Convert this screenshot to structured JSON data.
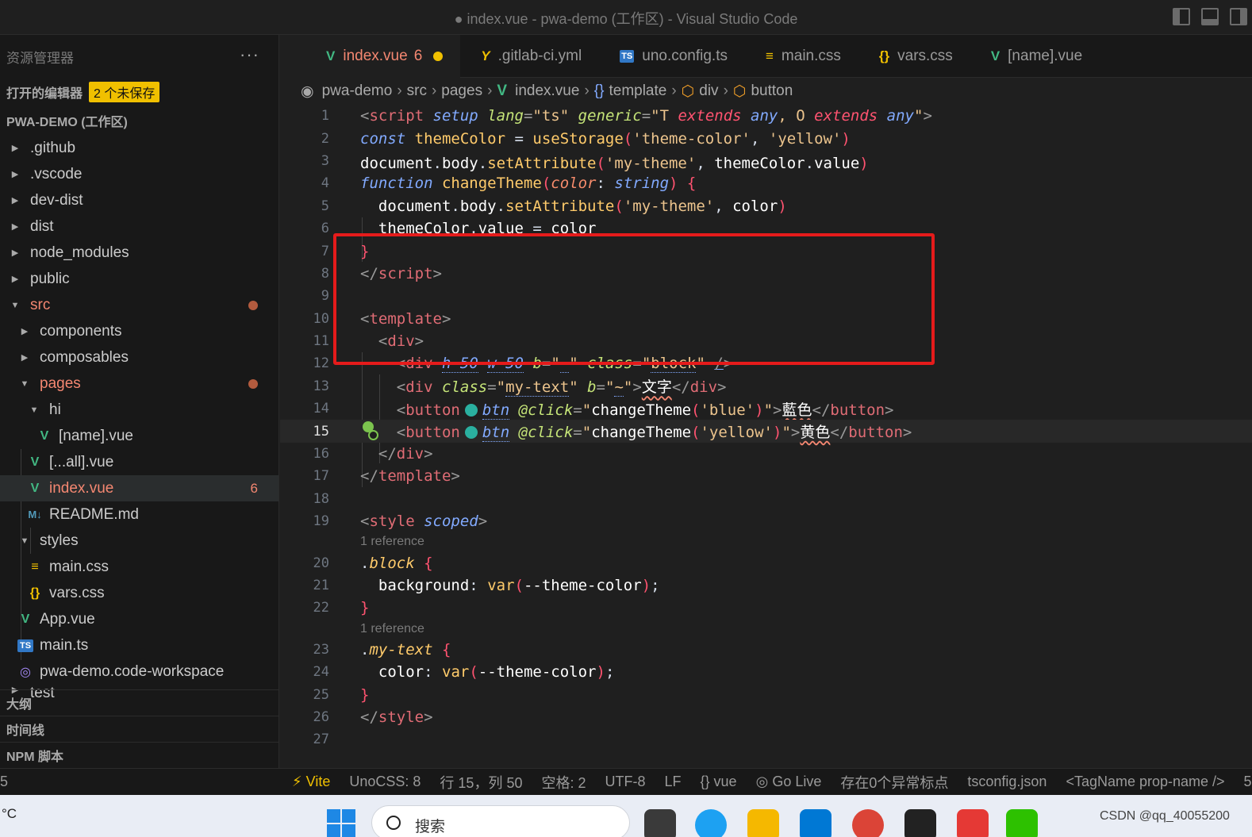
{
  "window": {
    "title": "● index.vue - pwa-demo (工作区) - Visual Studio Code"
  },
  "sidebar": {
    "header": "资源管理器",
    "more": "···",
    "open_editors": "打开的编辑器",
    "unsaved_badge": "2 个未保存",
    "workspace": "PWA-DEMO (工作区)",
    "items": [
      {
        "label": ".github"
      },
      {
        "label": ".vscode"
      },
      {
        "label": "dev-dist"
      },
      {
        "label": "dist"
      },
      {
        "label": "node_modules"
      },
      {
        "label": "public"
      },
      {
        "label": "src"
      },
      {
        "label": "components"
      },
      {
        "label": "composables"
      },
      {
        "label": "pages"
      },
      {
        "label": "hi"
      },
      {
        "label": "[name].vue"
      },
      {
        "label": "[...all].vue"
      },
      {
        "label": "index.vue",
        "count": "6"
      },
      {
        "label": "README.md"
      },
      {
        "label": "styles"
      },
      {
        "label": "main.css"
      },
      {
        "label": "vars.css"
      },
      {
        "label": "App.vue"
      },
      {
        "label": "main.ts"
      },
      {
        "label": "pwa-demo.code-workspace"
      },
      {
        "label": "test"
      }
    ],
    "bottom_sections": [
      "大纲",
      "时间线",
      "NPM 脚本"
    ]
  },
  "tabs": [
    {
      "label": "index.vue",
      "icon": "vue-icon",
      "errors": "6",
      "active": true
    },
    {
      "label": ".gitlab-ci.yml",
      "icon": "yaml-icon"
    },
    {
      "label": "uno.config.ts",
      "icon": "ts-icon"
    },
    {
      "label": "main.css",
      "icon": "css-icon"
    },
    {
      "label": "vars.css",
      "icon": "css-braces-icon"
    },
    {
      "label": "[name].vue",
      "icon": "vue-icon"
    }
  ],
  "breadcrumb": [
    "pwa-demo",
    "src",
    "pages",
    "index.vue",
    "template",
    "div",
    "button"
  ],
  "editor": {
    "current_line": "15",
    "codelens": "1 reference",
    "line_numbers": [
      "1",
      "2",
      "3",
      "4",
      "5",
      "6",
      "7",
      "8",
      "9",
      "10",
      "11",
      "12",
      "13",
      "14",
      "15",
      "16",
      "17",
      "18",
      "19",
      "20",
      "21",
      "22",
      "23",
      "24",
      "25",
      "26",
      "27"
    ]
  },
  "statusbar": {
    "vite": "Vite",
    "unocss": "UnoCSS: 8",
    "position": "行 15，列 50",
    "spaces": "空格: 2",
    "encoding": "UTF-8",
    "eol": "LF",
    "language": "vue",
    "golive": "Go Live",
    "problems": "存在0个异常标点",
    "tsconfig": "tsconfig.json",
    "tagname": "<TagName prop-name />",
    "left_edge": "5",
    "right_edge": "5"
  },
  "taskbar": {
    "temp": "°C",
    "search": "搜索",
    "tray": "CSDN @qq_40055200"
  },
  "accent_colors": {
    "modified": "#f48771",
    "unsaved_badge": "#f0c000",
    "highlight_box": "#e51b1b",
    "vue": "#42b883"
  }
}
